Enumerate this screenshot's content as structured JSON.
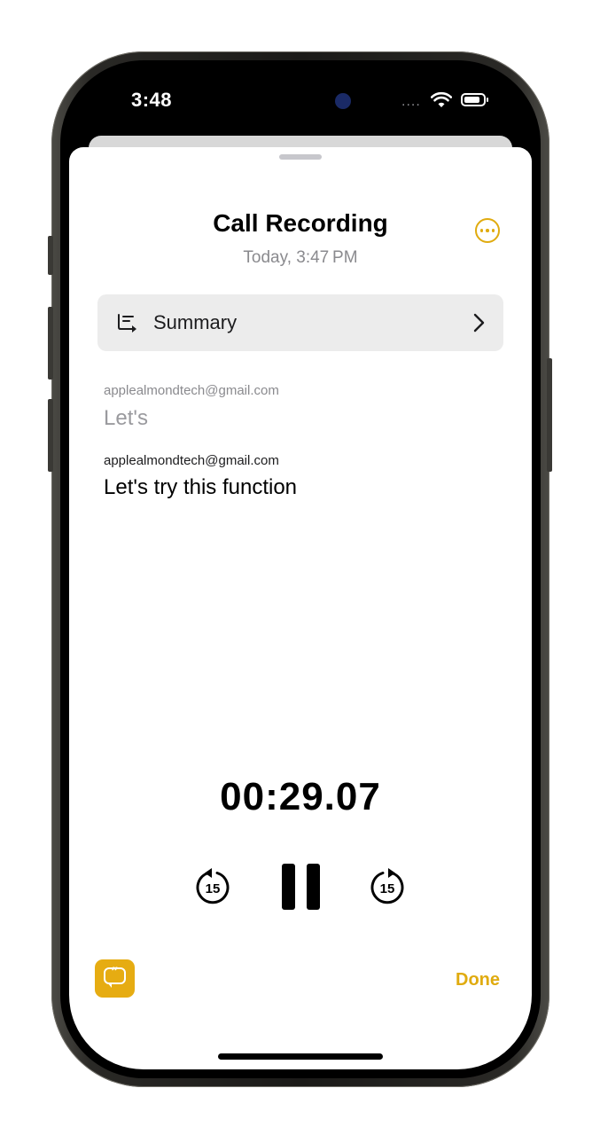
{
  "status_bar": {
    "time": "3:48",
    "signal": "....",
    "wifi_icon": "wifi-icon",
    "battery_icon": "battery-icon"
  },
  "header": {
    "title": "Call Recording",
    "subtitle": "Today, 3:47 PM",
    "more_icon": "ellipsis-circle-icon"
  },
  "summary": {
    "label": "Summary",
    "icon": "summary-list-icon",
    "chevron": "chevron-right-icon"
  },
  "transcript": [
    {
      "speaker": "applealmondtech@gmail.com",
      "text": "Let's",
      "state": "faded"
    },
    {
      "speaker": "applealmondtech@gmail.com",
      "text": "Let's try this function",
      "state": "active"
    }
  ],
  "player": {
    "elapsed": "00:29.07",
    "skip_back_seconds": "15",
    "skip_forward_seconds": "15",
    "state": "playing"
  },
  "footer": {
    "transcript_icon": "quote-bubble-icon",
    "done_label": "Done"
  },
  "colors": {
    "accent": "#e0ab0f",
    "summary_bg": "#ececec",
    "secondary_text": "#8a8a8e"
  }
}
